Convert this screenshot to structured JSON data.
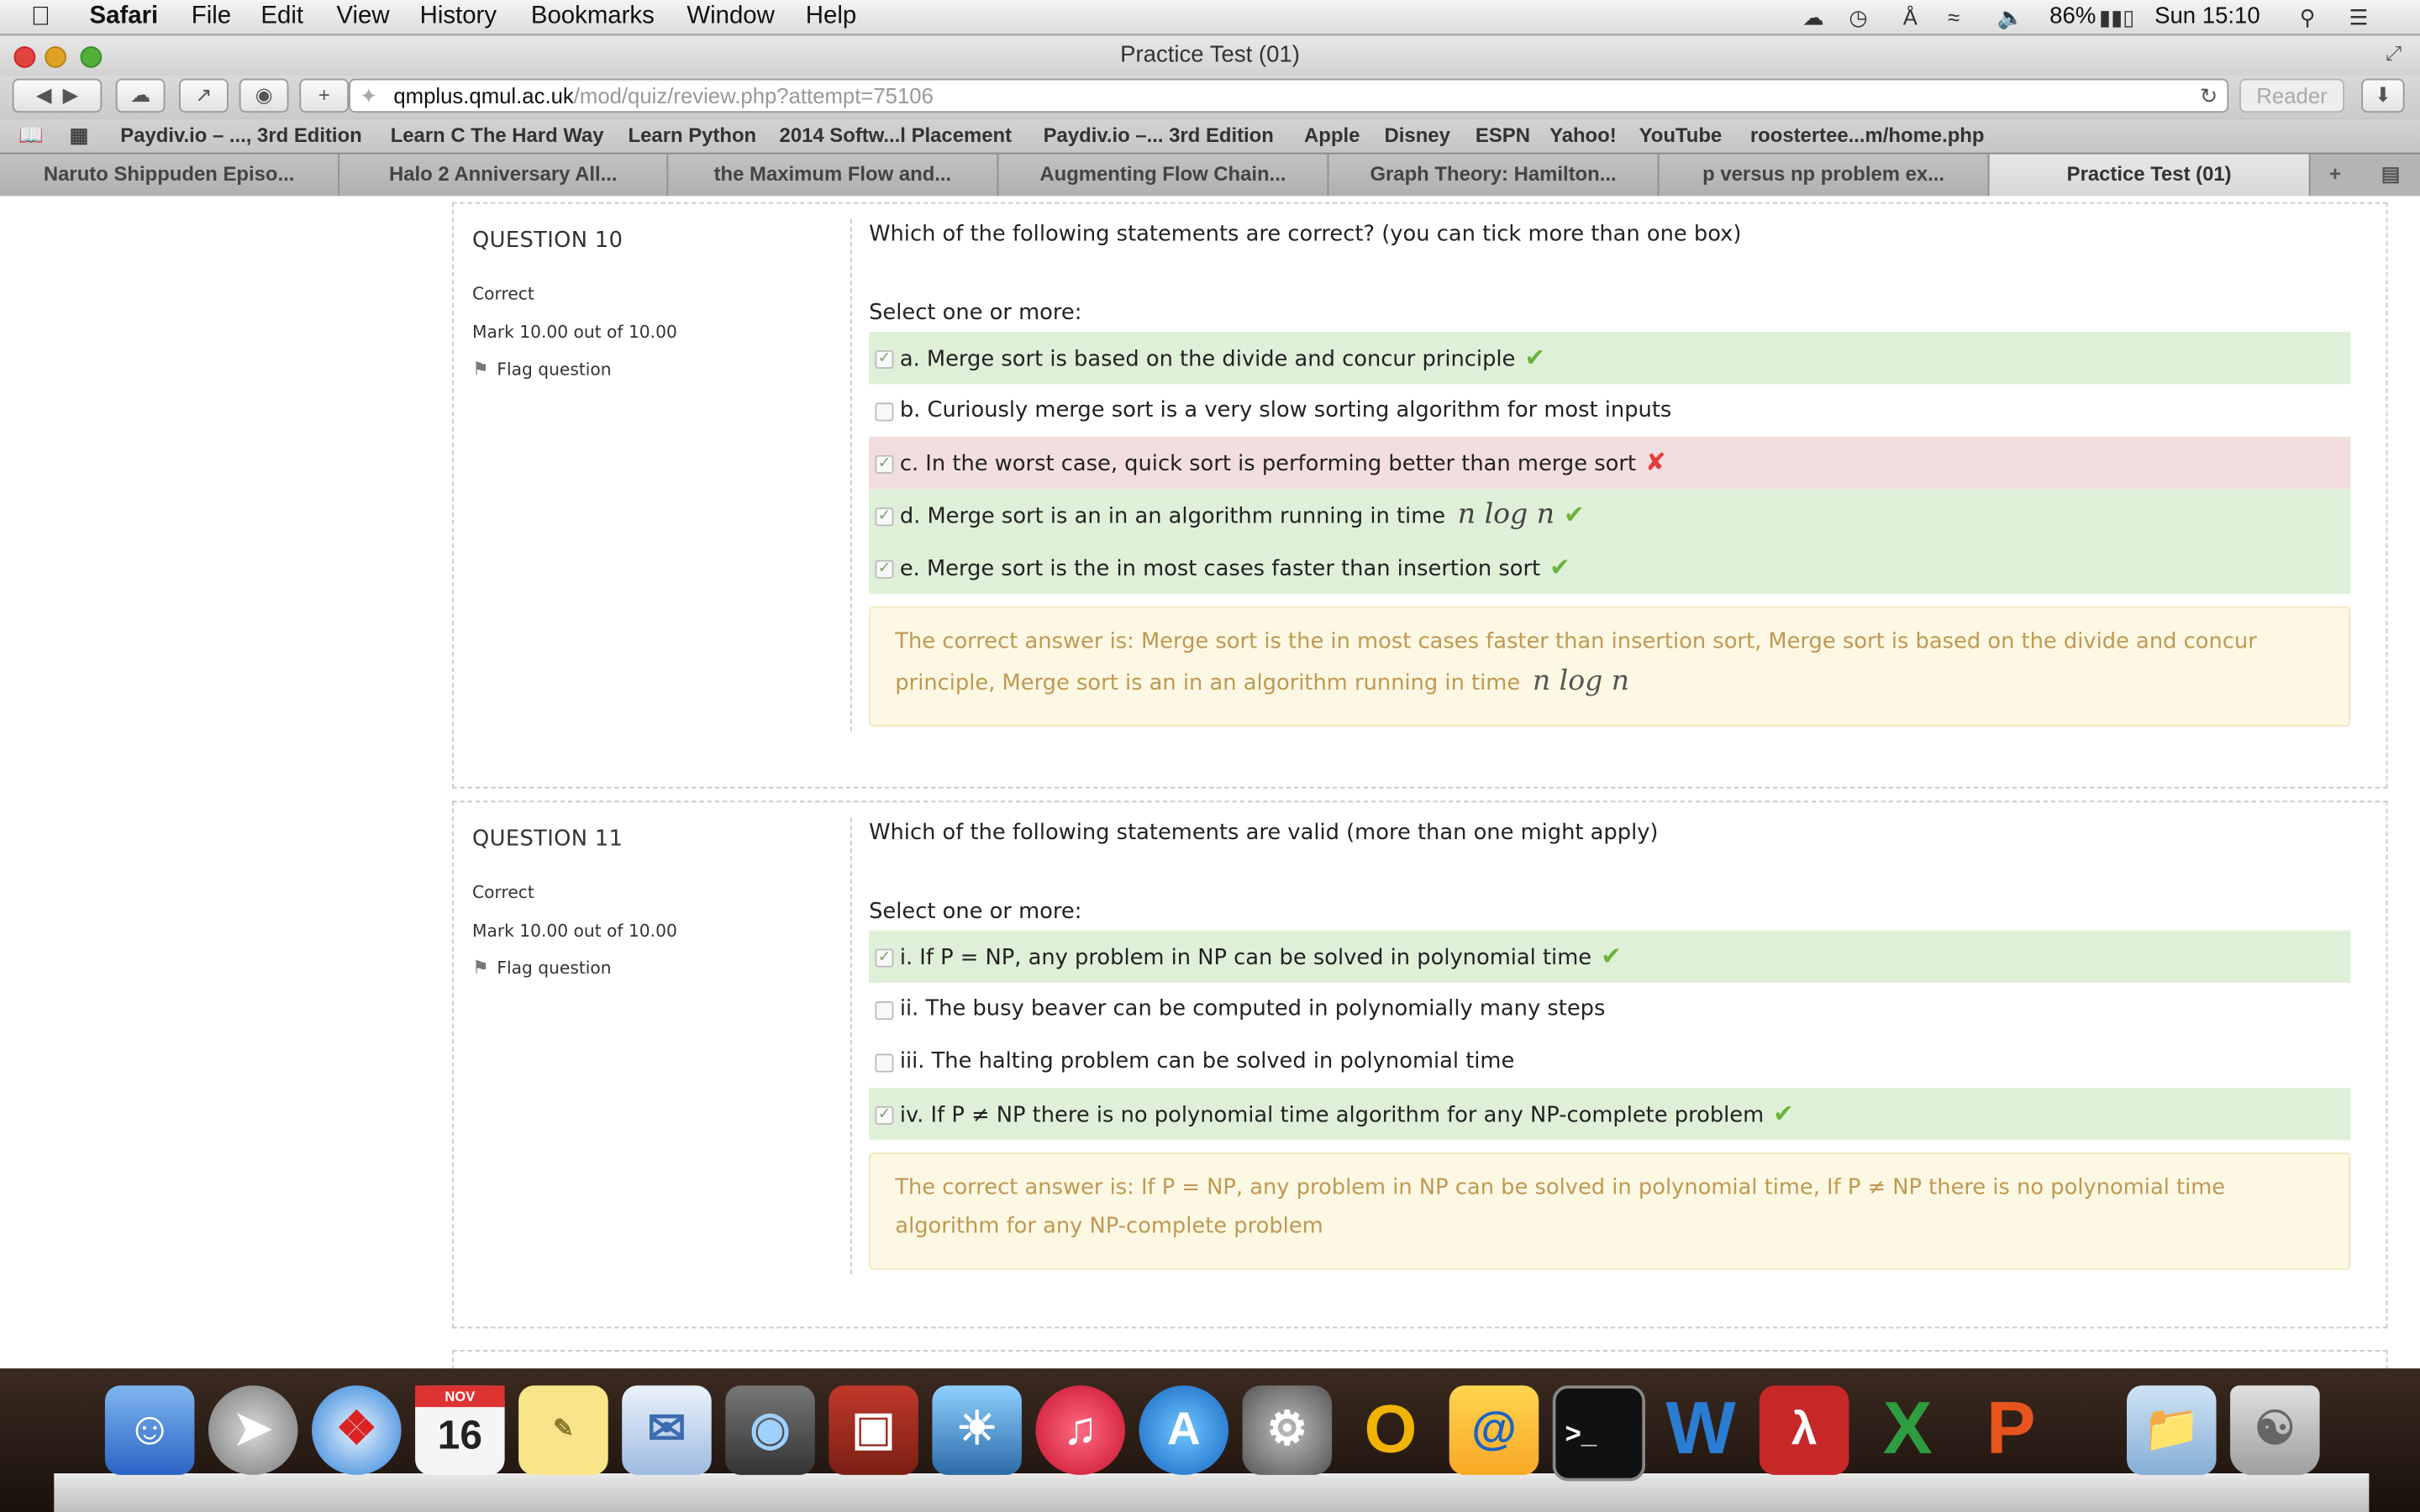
{
  "menubar": {
    "app": "Safari",
    "items": [
      "File",
      "Edit",
      "View",
      "History",
      "Bookmarks",
      "Window",
      "Help"
    ],
    "battery": "86%",
    "clock": "Sun 15:10"
  },
  "window": {
    "title": "Practice Test (01)"
  },
  "toolbar": {
    "url_host": "qmplus.qmul.ac.uk",
    "url_path": "/mod/quiz/review.php?attempt=75106",
    "reader_label": "Reader"
  },
  "bookmarks": [
    "Paydiv.io – ..., 3rd Edition",
    "Learn C The Hard Way",
    "Learn Python",
    "2014 Softw...l Placement",
    "Paydiv.io –... 3rd Edition",
    "Apple",
    "Disney",
    "ESPN",
    "Yahoo!",
    "YouTube",
    "roostertee...m/home.php"
  ],
  "tabs": [
    "Naruto Shippuden Episo...",
    "Halo 2 Anniversary All...",
    "the Maximum Flow and...",
    "Augmenting Flow Chain...",
    "Graph Theory: Hamilton...",
    "p versus np problem ex...",
    "Practice Test (01)"
  ],
  "questions": [
    {
      "number": "QUESTION 10",
      "state": "Correct",
      "grade": "Mark 10.00 out of 10.00",
      "flag_label": "Flag question",
      "text": "Which of the following statements are correct?  (you can tick more than one box)",
      "prompt": "Select one or more:",
      "answers": [
        {
          "label": "a. Merge sort is based on the divide and concur principle",
          "checked": true,
          "result": "correct"
        },
        {
          "label": "b. Curiously merge sort is a very slow sorting algorithm for most inputs",
          "checked": false,
          "result": "none"
        },
        {
          "label": "c. In the worst case, quick sort is performing better than merge sort",
          "checked": true,
          "result": "incorrect"
        },
        {
          "label": "d. Merge sort is an in an algorithm running in time",
          "math": "n log n",
          "checked": true,
          "result": "correct"
        },
        {
          "label": "e. Merge sort is the in most cases faster than insertion sort",
          "checked": true,
          "result": "correct"
        }
      ],
      "feedback": "The correct answer is: Merge sort is the in most cases faster than insertion sort, Merge sort is based on the divide and concur principle, Merge sort is an in an algorithm running in time",
      "feedback_math": "n log n"
    },
    {
      "number": "QUESTION 11",
      "state": "Correct",
      "grade": "Mark 10.00 out of 10.00",
      "flag_label": "Flag question",
      "text": "Which of the following statements are valid (more than one might apply)",
      "prompt": "Select one or more:",
      "answers": [
        {
          "label": "i. If P = NP, any problem in NP can be solved in polynomial time",
          "checked": true,
          "result": "correct"
        },
        {
          "label": "ii. The busy beaver can be computed in polynomially many steps",
          "checked": false,
          "result": "none"
        },
        {
          "label": "iii. The halting problem can be solved in polynomial time",
          "checked": false,
          "result": "none"
        },
        {
          "label": "iv. If P ≠ NP there is no polynomial time algorithm for any NP-complete problem",
          "checked": true,
          "result": "correct"
        }
      ],
      "feedback": "The correct answer is: If P = NP, any problem in NP can be solved in polynomial time, If P ≠ NP there is no polynomial time algorithm for any NP-complete problem"
    }
  ],
  "dock": [
    "Finder",
    "Launchpad",
    "Safari",
    "Calendar",
    "Stickies",
    "Mail",
    "FaceTime",
    "Photo Booth",
    "iPhoto",
    "iTunes",
    "App Store",
    "System Preferences",
    "Outlook",
    "Fetch",
    "Terminal",
    "Word",
    "Acrobat",
    "Excel",
    "PowerPoint",
    "Documents",
    "Trash"
  ],
  "calendar_month": "NOV",
  "calendar_day": "16",
  "colors": {
    "correct_bg": "#dff0d8",
    "incorrect_bg": "#f2dede",
    "feedback_bg": "#fcf8e3",
    "feedback_text": "#c09853",
    "check_green": "#6cb33e",
    "cross_red": "#e53c3c"
  }
}
